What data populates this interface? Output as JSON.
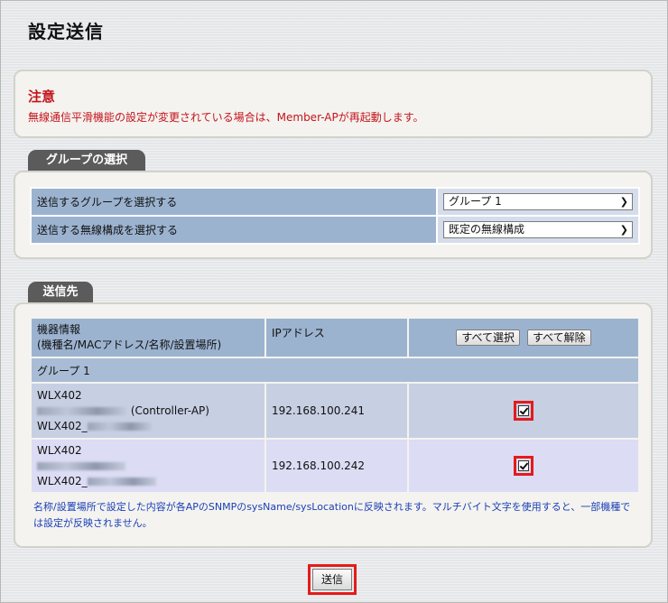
{
  "page": {
    "title": "設定送信"
  },
  "notice": {
    "title": "注意",
    "text": "無線通信平滑機能の設定が変更されている場合は、Member-APが再起動します。"
  },
  "group_section": {
    "tab": "グループの選択",
    "rows": [
      {
        "label": "送信するグループを選択する",
        "selected": "グループ 1"
      },
      {
        "label": "送信する無線構成を選択する",
        "selected": "既定の無線構成"
      }
    ]
  },
  "dest_section": {
    "tab": "送信先",
    "headers": {
      "device_info_line1": "機器情報",
      "device_info_line2": "(機種名/MACアドレス/名称/設置場所)",
      "ip": "IPアドレス",
      "select_all": "すべて選択",
      "deselect_all": "すべて解除"
    },
    "group_label": "グループ 1",
    "devices": [
      {
        "model": "WLX402",
        "role": "(Controller-AP)",
        "name_prefix": "WLX402_",
        "ip": "192.168.100.241",
        "checked": true
      },
      {
        "model": "WLX402",
        "role": "",
        "name_prefix": "WLX402_",
        "ip": "192.168.100.242",
        "checked": true
      }
    ],
    "note": "名称/設置場所で設定した内容が各APのSNMPのsysName/sysLocationに反映されます。マルチバイト文字を使用すると、一部機種では設定が反映されません。"
  },
  "footer": {
    "send_label": "送信"
  },
  "colors": {
    "accent_red": "#e41b1b",
    "notice_red": "#c4141c",
    "note_blue": "#1a3fb8",
    "header_blue": "#9cb3d0"
  }
}
